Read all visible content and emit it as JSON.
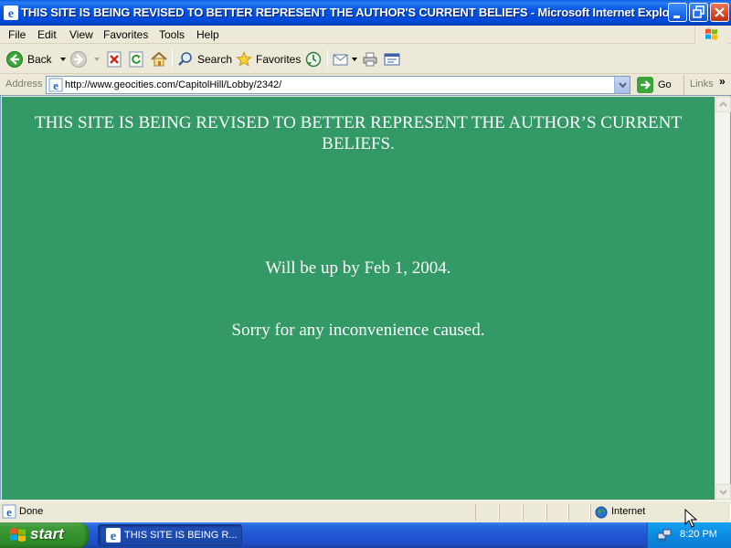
{
  "window": {
    "title": "THIS SITE IS BEING REVISED TO BETTER REPRESENT THE AUTHOR'S CURRENT BELIEFS - Microsoft Internet Explorer"
  },
  "menubar": {
    "items": [
      "File",
      "Edit",
      "View",
      "Favorites",
      "Tools",
      "Help"
    ]
  },
  "toolbar": {
    "back_label": "Back",
    "search_label": "Search",
    "favorites_label": "Favorites"
  },
  "addressbar": {
    "label": "Address",
    "url": "http://www.geocities.com/CapitolHill/Lobby/2342/",
    "go_label": "Go",
    "links_label": "Links"
  },
  "page": {
    "headline": "THIS SITE IS BEING REVISED TO BETTER REPRESENT THE AUTHOR’S CURRENT BELIEFS.",
    "line1": "Will be up by Feb 1, 2004.",
    "line2": "Sorry for any inconvenience caused.",
    "background_color": "#339966"
  },
  "statusbar": {
    "status": "Done",
    "zone": "Internet"
  },
  "taskbar": {
    "start_label": "start",
    "task_label": "THIS SITE IS BEING R...",
    "clock": "8:20 PM"
  }
}
